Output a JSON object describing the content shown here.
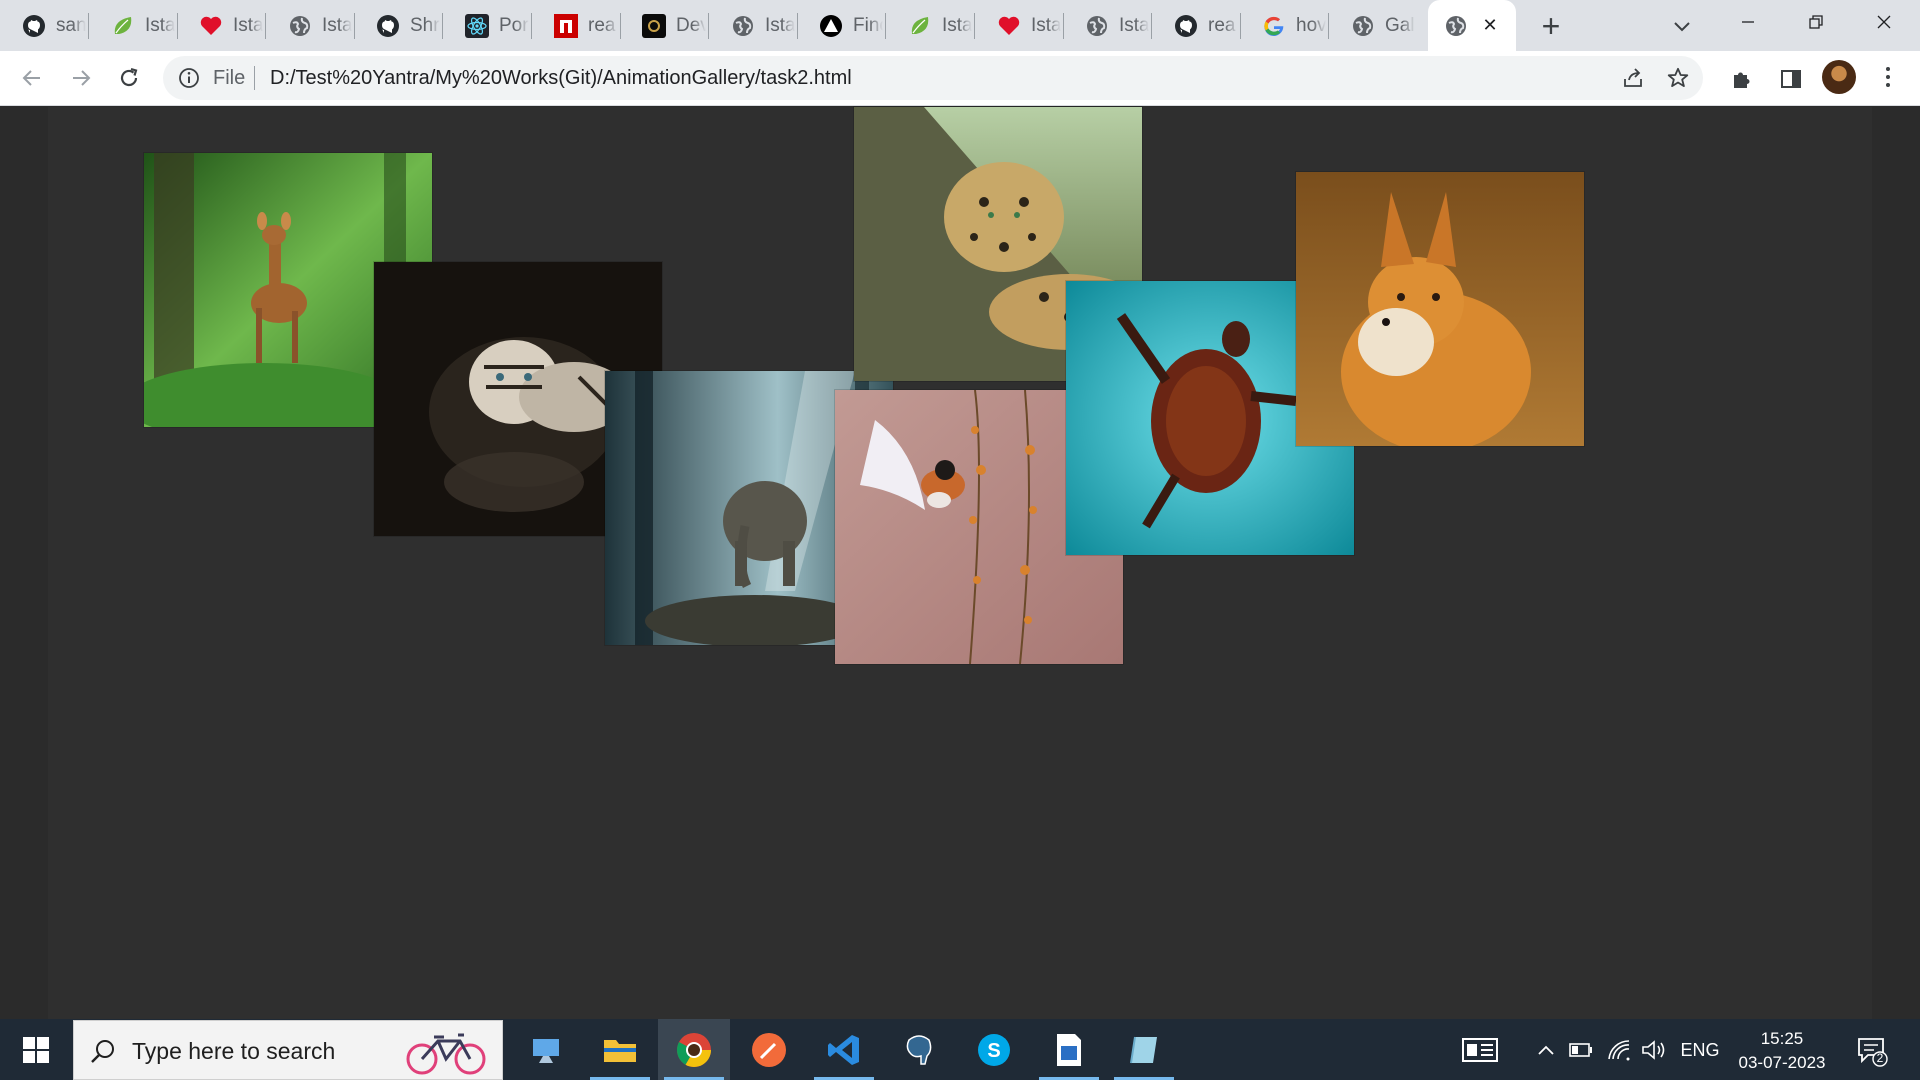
{
  "tabs": [
    {
      "label": "san",
      "icon": "github-icon"
    },
    {
      "label": "Ista",
      "icon": "spring-leaf-icon"
    },
    {
      "label": "Ista",
      "icon": "heart-icon"
    },
    {
      "label": "Ista",
      "icon": "globe-icon"
    },
    {
      "label": "Shr",
      "icon": "github-icon"
    },
    {
      "label": "Por",
      "icon": "react-icon"
    },
    {
      "label": "rea",
      "icon": "red-square-icon"
    },
    {
      "label": "Dev",
      "icon": "devlogo-icon"
    },
    {
      "label": "Ista",
      "icon": "globe-icon"
    },
    {
      "label": "Finc",
      "icon": "triangle-icon"
    },
    {
      "label": "Ista",
      "icon": "spring-leaf-icon"
    },
    {
      "label": "Ista",
      "icon": "heart-icon"
    },
    {
      "label": "Ista",
      "icon": "globe-icon"
    },
    {
      "label": "rea",
      "icon": "github-icon"
    },
    {
      "label": "hov",
      "icon": "google-icon"
    },
    {
      "label": "Gall",
      "icon": "globe-icon"
    },
    {
      "label": "",
      "icon": "globe-icon",
      "active": true
    }
  ],
  "toolbar": {
    "scheme_label": "File",
    "url": "D:/Test%20Yantra/My%20Works(Git)/AnimationGallery/task2.html"
  },
  "gallery": {
    "photos": [
      {
        "name": "deer",
        "colors": [
          "#2e6b1f",
          "#7dc25a",
          "#a56b38"
        ]
      },
      {
        "name": "white-tiger",
        "colors": [
          "#1b1713",
          "#3a332b",
          "#d8d0c2"
        ]
      },
      {
        "name": "elephant",
        "colors": [
          "#2f4850",
          "#a9c6cd",
          "#5d5b50"
        ]
      },
      {
        "name": "leopard",
        "colors": [
          "#5b6a3c",
          "#c5a465",
          "#2f2a1f"
        ]
      },
      {
        "name": "bird",
        "colors": [
          "#b98a86",
          "#e7c8c0",
          "#c86a2a"
        ]
      },
      {
        "name": "turtle",
        "colors": [
          "#1aa4b4",
          "#6fe0ea",
          "#6a2514"
        ]
      },
      {
        "name": "fox",
        "colors": [
          "#8a5a22",
          "#d9892f",
          "#efe2cc"
        ]
      }
    ]
  },
  "taskbar": {
    "search_placeholder": "Type here to search",
    "language": "ENG",
    "time": "15:25",
    "date": "03-07-2023",
    "notification_count": "2"
  }
}
